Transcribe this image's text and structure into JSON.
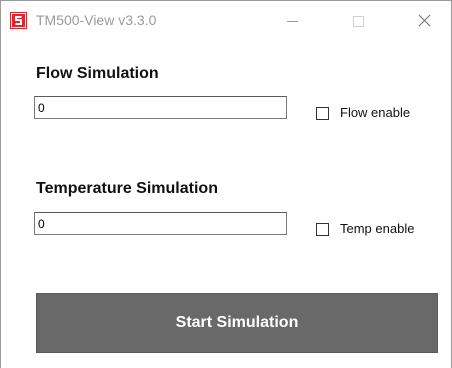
{
  "window": {
    "title": "TM500-View v3.3.0",
    "icon": "app-logo-icon",
    "icon_color": "#e3262b",
    "controls": [
      "minimize-icon",
      "maximize-icon",
      "close-icon"
    ]
  },
  "flow": {
    "label": "Flow Simulation",
    "value": "0",
    "enable_label": "Flow enable",
    "enabled": false
  },
  "temperature": {
    "label": "Temperature Simulation",
    "value": "0",
    "enable_label": "Temp enable",
    "enabled": false
  },
  "actions": {
    "start_label": "Start Simulation",
    "start_color": "#696969"
  }
}
